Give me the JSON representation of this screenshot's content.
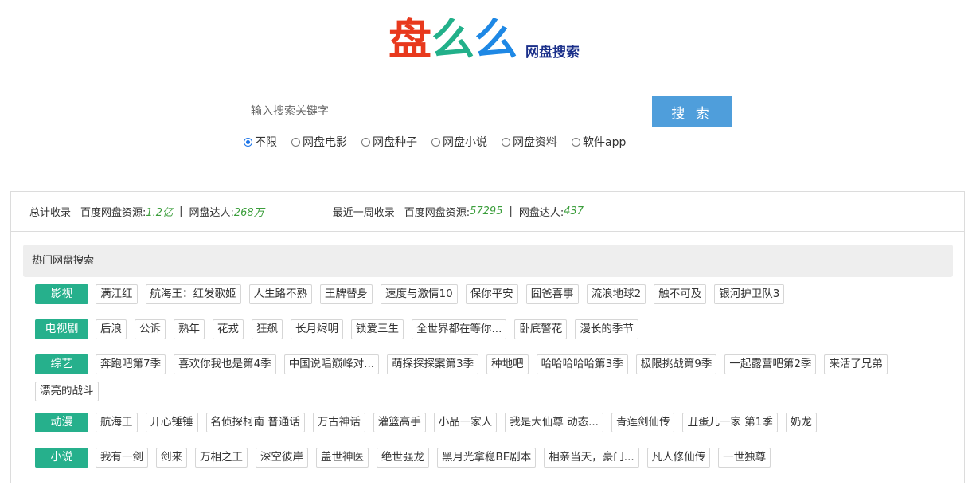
{
  "logo": {
    "chars": [
      {
        "text": "盘",
        "color": "#e8391d"
      },
      {
        "text": "么",
        "color": "#22b08a"
      },
      {
        "text": "么",
        "color": "#1e88e5"
      }
    ],
    "subtitle": "网盘搜索"
  },
  "search": {
    "placeholder": "输入搜索关键字",
    "button": "搜 索"
  },
  "filters": [
    {
      "label": "不限",
      "checked": true
    },
    {
      "label": "网盘电影",
      "checked": false
    },
    {
      "label": "网盘种子",
      "checked": false
    },
    {
      "label": "网盘小说",
      "checked": false
    },
    {
      "label": "网盘资料",
      "checked": false
    },
    {
      "label": "软件app",
      "checked": false
    }
  ],
  "stats": {
    "total": {
      "title": "总计收录",
      "baidu_label": "百度网盘资源:",
      "baidu_value": "1.2亿",
      "sep": "|",
      "expert_label": "网盘达人:",
      "expert_value": "268万"
    },
    "week": {
      "title": "最近一周收录",
      "baidu_label": "百度网盘资源:",
      "baidu_value": "57295",
      "sep": "|",
      "expert_label": "网盘达人:",
      "expert_value": "437"
    }
  },
  "hot": {
    "title": "热门网盘搜索",
    "categories": [
      {
        "name": "影视",
        "tags": [
          "满江红",
          "航海王：红发歌姬",
          "人生路不熟",
          "王牌替身",
          "速度与激情10",
          "保你平安",
          "囧爸喜事",
          "流浪地球2",
          "触不可及",
          "银河护卫队3"
        ]
      },
      {
        "name": "电视剧",
        "tags": [
          "后浪",
          "公诉",
          "熟年",
          "花戎",
          "狂飙",
          "长月烬明",
          "锁爱三生",
          "全世界都在等你...",
          "卧底警花",
          "漫长的季节"
        ]
      },
      {
        "name": "综艺",
        "tags": [
          "奔跑吧第7季",
          "喜欢你我也是第4季",
          "中国说唱巅峰对...",
          "萌探探探案第3季",
          "种地吧",
          "哈哈哈哈哈第3季",
          "极限挑战第9季",
          "一起露营吧第2季",
          "来活了兄弟",
          "漂亮的战斗"
        ]
      },
      {
        "name": "动漫",
        "tags": [
          "航海王",
          "开心锤锤",
          "名侦探柯南 普通话",
          "万古神话",
          "灌篮高手",
          "小品一家人",
          "我是大仙尊 动态...",
          "青莲剑仙传",
          "丑蛋儿一家 第1季",
          "奶龙"
        ]
      },
      {
        "name": "小说",
        "tags": [
          "我有一剑",
          "剑来",
          "万相之王",
          "深空彼岸",
          "盖世神医",
          "绝世强龙",
          "黑月光拿稳BE剧本",
          "相亲当天，豪门...",
          "凡人修仙传",
          "一世独尊"
        ]
      }
    ]
  }
}
